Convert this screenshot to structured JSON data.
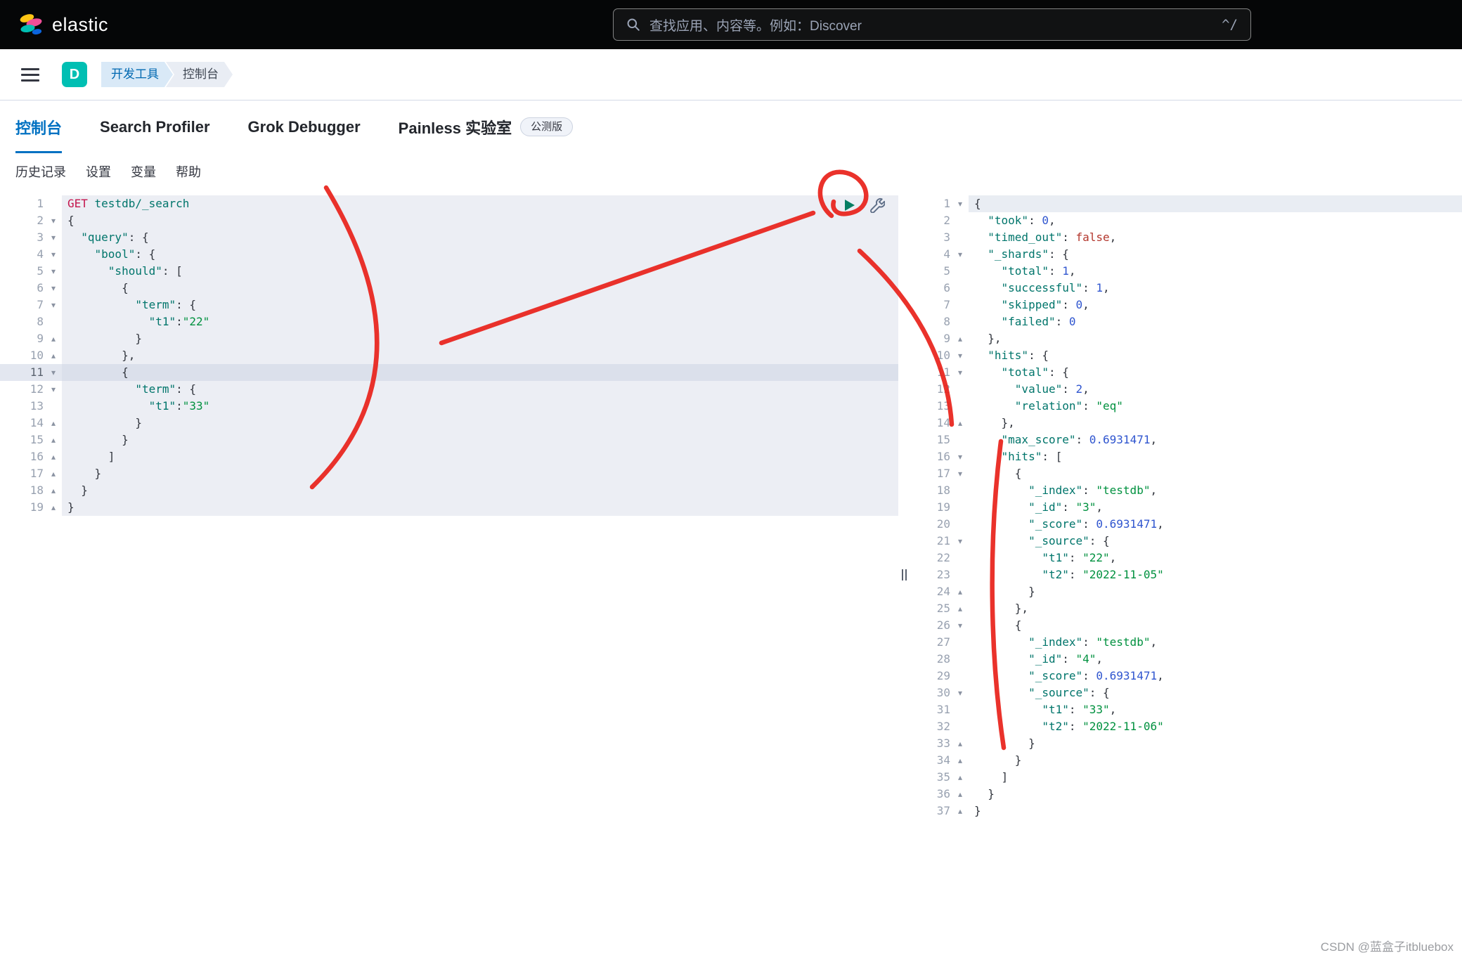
{
  "colors": {
    "accent_blue": "#0071c2",
    "brand_teal": "#00bfb3",
    "annotation_red": "#e8221b"
  },
  "header": {
    "brand": "elastic",
    "search_placeholder": "查找应用、内容等。例如：Discover",
    "shortcut_hint": "^/"
  },
  "nav": {
    "space_badge": "D",
    "breadcrumbs": [
      {
        "label": "开发工具"
      },
      {
        "label": "控制台"
      }
    ]
  },
  "tabs": [
    {
      "name": "console",
      "label": "控制台",
      "active": true
    },
    {
      "name": "search-profiler",
      "label": "Search Profiler"
    },
    {
      "name": "grok-debugger",
      "label": "Grok Debugger"
    },
    {
      "name": "painless-lab",
      "label": "Painless 实验室",
      "badge": "公测版"
    }
  ],
  "console_menu": [
    {
      "name": "history",
      "label": "历史记录"
    },
    {
      "name": "settings",
      "label": "设置"
    },
    {
      "name": "variables",
      "label": "变量"
    },
    {
      "name": "help",
      "label": "帮助"
    }
  ],
  "request_editor": {
    "active_line": 11,
    "lines": [
      "GET testdb/_search",
      "{",
      "  \"query\": {",
      "    \"bool\": {",
      "      \"should\": [",
      "        {",
      "          \"term\": {",
      "            \"t1\":\"22\"",
      "          }",
      "        },",
      "        {",
      "          \"term\": {",
      "            \"t1\":\"33\"",
      "          }",
      "        }",
      "      ]",
      "    }",
      "  }",
      "}"
    ]
  },
  "response_editor": {
    "active_line": 1,
    "lines": [
      "{",
      "  \"took\": 0,",
      "  \"timed_out\": false,",
      "  \"_shards\": {",
      "    \"total\": 1,",
      "    \"successful\": 1,",
      "    \"skipped\": 0,",
      "    \"failed\": 0",
      "  },",
      "  \"hits\": {",
      "    \"total\": {",
      "      \"value\": 2,",
      "      \"relation\": \"eq\"",
      "    },",
      "    \"max_score\": 0.6931471,",
      "    \"hits\": [",
      "      {",
      "        \"_index\": \"testdb\",",
      "        \"_id\": \"3\",",
      "        \"_score\": 0.6931471,",
      "        \"_source\": {",
      "          \"t1\": \"22\",",
      "          \"t2\": \"2022-11-05\"",
      "        }",
      "      },",
      "      {",
      "        \"_index\": \"testdb\",",
      "        \"_id\": \"4\",",
      "        \"_score\": 0.6931471,",
      "        \"_source\": {",
      "          \"t1\": \"33\",",
      "          \"t2\": \"2022-11-06\"",
      "        }",
      "      }",
      "    ]",
      "  }",
      "}"
    ]
  },
  "annotations": {
    "color": "#e8221b",
    "strokes": [
      "M 464 267 Q 618 522 444 693",
      "M 628 488 Q 872 402 1157 303",
      "M 1183 307 C 1156 285 1164 241 1199 245 C 1237 250 1247 299 1205 304 C 1192 306 1183 299 1186 287",
      "M 1223 357 Q 1345 470 1354 604",
      "M 1424 628 C 1406 770 1408 930 1428 1064"
    ]
  },
  "watermark": "CSDN @蓝盒子itbluebox"
}
